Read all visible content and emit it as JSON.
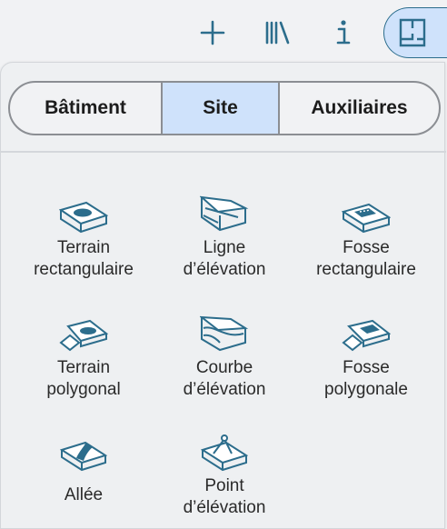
{
  "toolbar": {
    "add_icon": "plus-icon",
    "library_icon": "library-icon",
    "info_icon": "info-icon",
    "layout_icon": "floorplan-icon"
  },
  "tabs": [
    {
      "label": "Bâtiment",
      "active": false
    },
    {
      "label": "Site",
      "active": true
    },
    {
      "label": "Auxiliaires",
      "active": false
    }
  ],
  "tools": [
    {
      "label": "Terrain\nrectangulaire",
      "icon": "rectangular-terrain-icon"
    },
    {
      "label": "Ligne\nd’élévation",
      "icon": "elevation-line-icon"
    },
    {
      "label": "Fosse\nrectangulaire",
      "icon": "rectangular-pit-icon"
    },
    {
      "label": "Terrain\npolygonal",
      "icon": "polygonal-terrain-icon"
    },
    {
      "label": "Courbe\nd’élévation",
      "icon": "elevation-curve-icon"
    },
    {
      "label": "Fosse\npolygonale",
      "icon": "polygonal-pit-icon"
    },
    {
      "label": "Allée",
      "icon": "driveway-icon"
    },
    {
      "label": "Point\nd’élévation",
      "icon": "elevation-point-icon"
    }
  ],
  "colors": {
    "accent": "#2c6d8c",
    "active_bg": "#cfe2fb"
  }
}
